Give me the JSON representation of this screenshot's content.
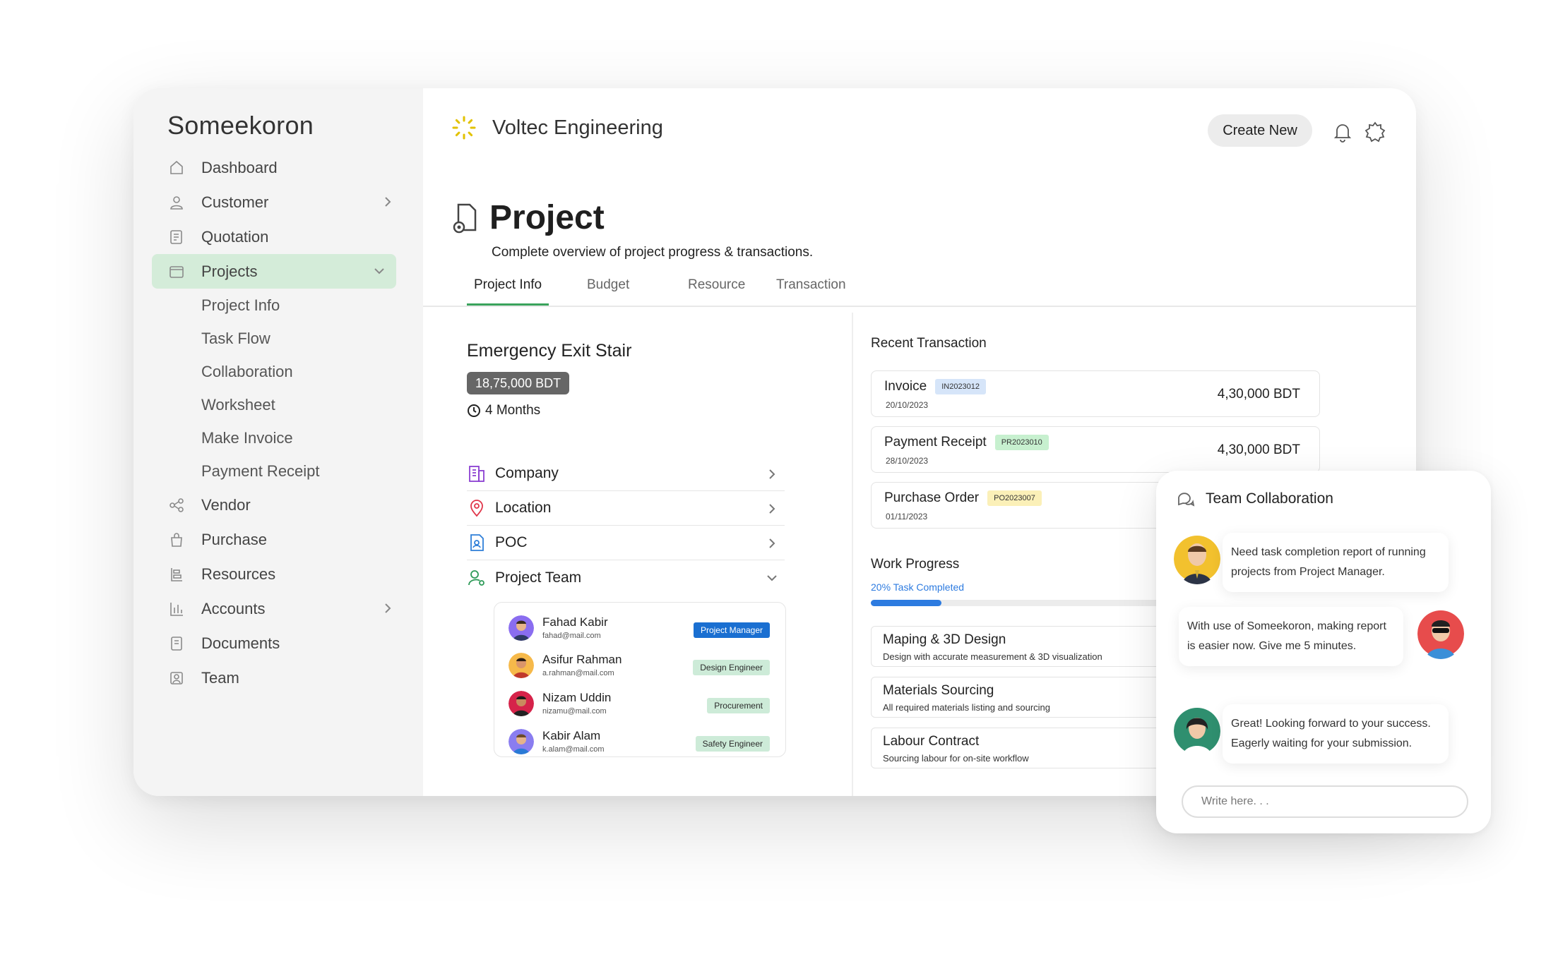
{
  "brand": "Someekoron",
  "sidebar": {
    "items": [
      {
        "label": "Dashboard",
        "icon": "home-icon"
      },
      {
        "label": "Customer",
        "icon": "user-icon"
      },
      {
        "label": "Quotation",
        "icon": "quotation-icon"
      },
      {
        "label": "Projects",
        "icon": "folder-icon"
      },
      {
        "label": "Vendor",
        "icon": "share-icon"
      },
      {
        "label": "Purchase",
        "icon": "bag-icon"
      },
      {
        "label": "Resources",
        "icon": "resources-icon"
      },
      {
        "label": "Accounts",
        "icon": "bar-chart-icon"
      },
      {
        "label": "Documents",
        "icon": "document-icon"
      },
      {
        "label": "Team",
        "icon": "team-icon"
      }
    ],
    "projects_sub": [
      "Project Info",
      "Task Flow",
      "Collaboration",
      "Worksheet",
      "Make Invoice",
      "Payment Receipt"
    ],
    "active_color": "#d4ecd9"
  },
  "header": {
    "company": "Voltec Engineering",
    "create_label": "Create New"
  },
  "page": {
    "title": "Project",
    "subtitle": "Complete overview of project progress & transactions."
  },
  "tabs": [
    "Project Info",
    "Budget",
    "Resource",
    "Transaction"
  ],
  "project": {
    "name": "Emergency Exit Stair",
    "budget": "18,75,000 BDT",
    "duration": "4 Months",
    "info_rows": [
      "Company",
      "Location",
      "POC",
      "Project Team"
    ]
  },
  "team": [
    {
      "name": "Fahad Kabir",
      "email": "fahad@mail.com",
      "role": "Project Manager"
    },
    {
      "name": "Asifur Rahman",
      "email": "a.rahman@mail.com",
      "role": "Design Engineer"
    },
    {
      "name": "Nizam Uddin",
      "email": "nizamu@mail.com",
      "role": "Procurement"
    },
    {
      "name": "Kabir Alam",
      "email": "k.alam@mail.com",
      "role": "Safety Engineer"
    }
  ],
  "recent_transaction": {
    "title": "Recent Transaction",
    "items": [
      {
        "type": "Invoice",
        "code": "IN2023012",
        "date": "20/10/2023",
        "amount": "4,30,000 BDT"
      },
      {
        "type": "Payment Receipt",
        "code": "PR2023010",
        "date": "28/10/2023",
        "amount": "4,30,000 BDT"
      },
      {
        "type": "Purchase Order",
        "code": "PO2023007",
        "date": "01/11/2023",
        "amount": ""
      }
    ]
  },
  "work_progress": {
    "title": "Work Progress",
    "label": "20% Task Completed",
    "percent": 20,
    "items": [
      {
        "title": "Maping & 3D Design",
        "desc": "Design with accurate measurement & 3D visualization"
      },
      {
        "title": "Materials Sourcing",
        "desc": "All required materials listing and sourcing"
      },
      {
        "title": "Labour Contract",
        "desc": "Sourcing labour for on-site workflow"
      }
    ]
  },
  "chat": {
    "title": "Team Collaboration",
    "messages": [
      "Need task completion report of running projects from Project Manager.",
      "With use of Someekoron, making report is easier now. Give me 5 minutes.",
      "Great! Looking forward to your success. Eagerly waiting for your submission."
    ],
    "placeholder": "Write here. . ."
  }
}
